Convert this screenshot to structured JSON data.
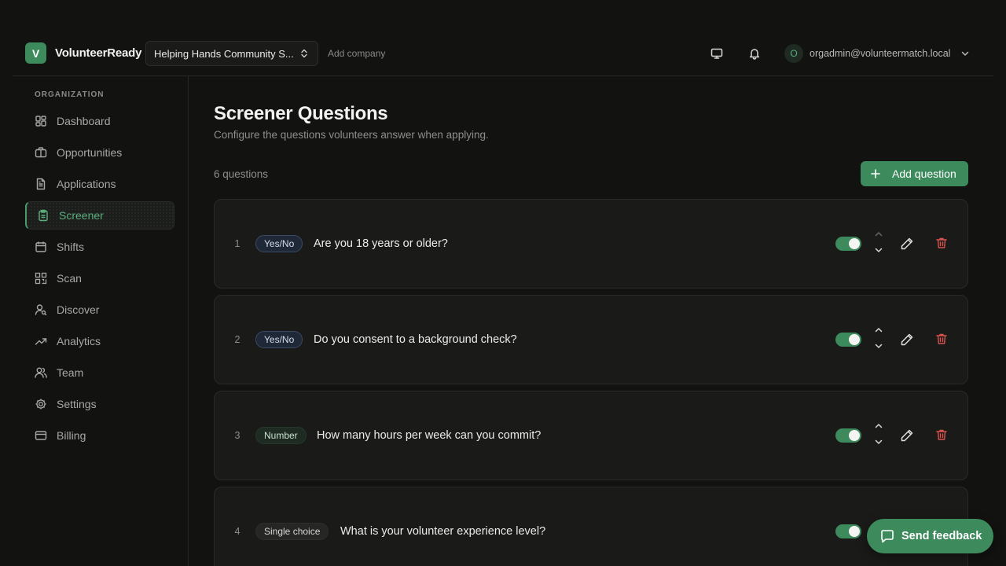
{
  "header": {
    "logo_letter": "V",
    "app_name": "VolunteerReady",
    "company": "Helping Hands Community S...",
    "add_company": "Add company",
    "user_initial": "O",
    "user_email": "orgadmin@volunteermatch.local"
  },
  "sidebar": {
    "heading": "ORGANIZATION",
    "items": [
      {
        "label": "Dashboard",
        "icon": "dashboard-icon"
      },
      {
        "label": "Opportunities",
        "icon": "briefcase-icon"
      },
      {
        "label": "Applications",
        "icon": "document-icon"
      },
      {
        "label": "Screener",
        "icon": "clipboard-icon",
        "active": true
      },
      {
        "label": "Shifts",
        "icon": "calendar-icon"
      },
      {
        "label": "Scan",
        "icon": "qr-code-icon"
      },
      {
        "label": "Discover",
        "icon": "user-search-icon"
      },
      {
        "label": "Analytics",
        "icon": "trending-up-icon"
      },
      {
        "label": "Team",
        "icon": "users-icon"
      },
      {
        "label": "Settings",
        "icon": "gear-icon"
      },
      {
        "label": "Billing",
        "icon": "credit-card-icon"
      }
    ]
  },
  "main": {
    "title": "Screener Questions",
    "subtitle": "Configure the questions volunteers answer when applying.",
    "count": "6 questions",
    "add_button": "Add question",
    "questions": [
      {
        "num": "1",
        "type": "Yes/No",
        "text": "Are you 18 years or older?",
        "enabled": true
      },
      {
        "num": "2",
        "type": "Yes/No",
        "text": "Do you consent to a background check?",
        "enabled": true
      },
      {
        "num": "3",
        "type": "Number",
        "text": "How many hours per week can you commit?",
        "enabled": true
      },
      {
        "num": "4",
        "type": "Single choice",
        "text": "What is your volunteer experience level?",
        "enabled": true
      }
    ]
  },
  "feedback": {
    "label": "Send feedback"
  },
  "colors": {
    "accent": "#3d8a5c",
    "danger": "#d9534f",
    "background": "#121211"
  }
}
